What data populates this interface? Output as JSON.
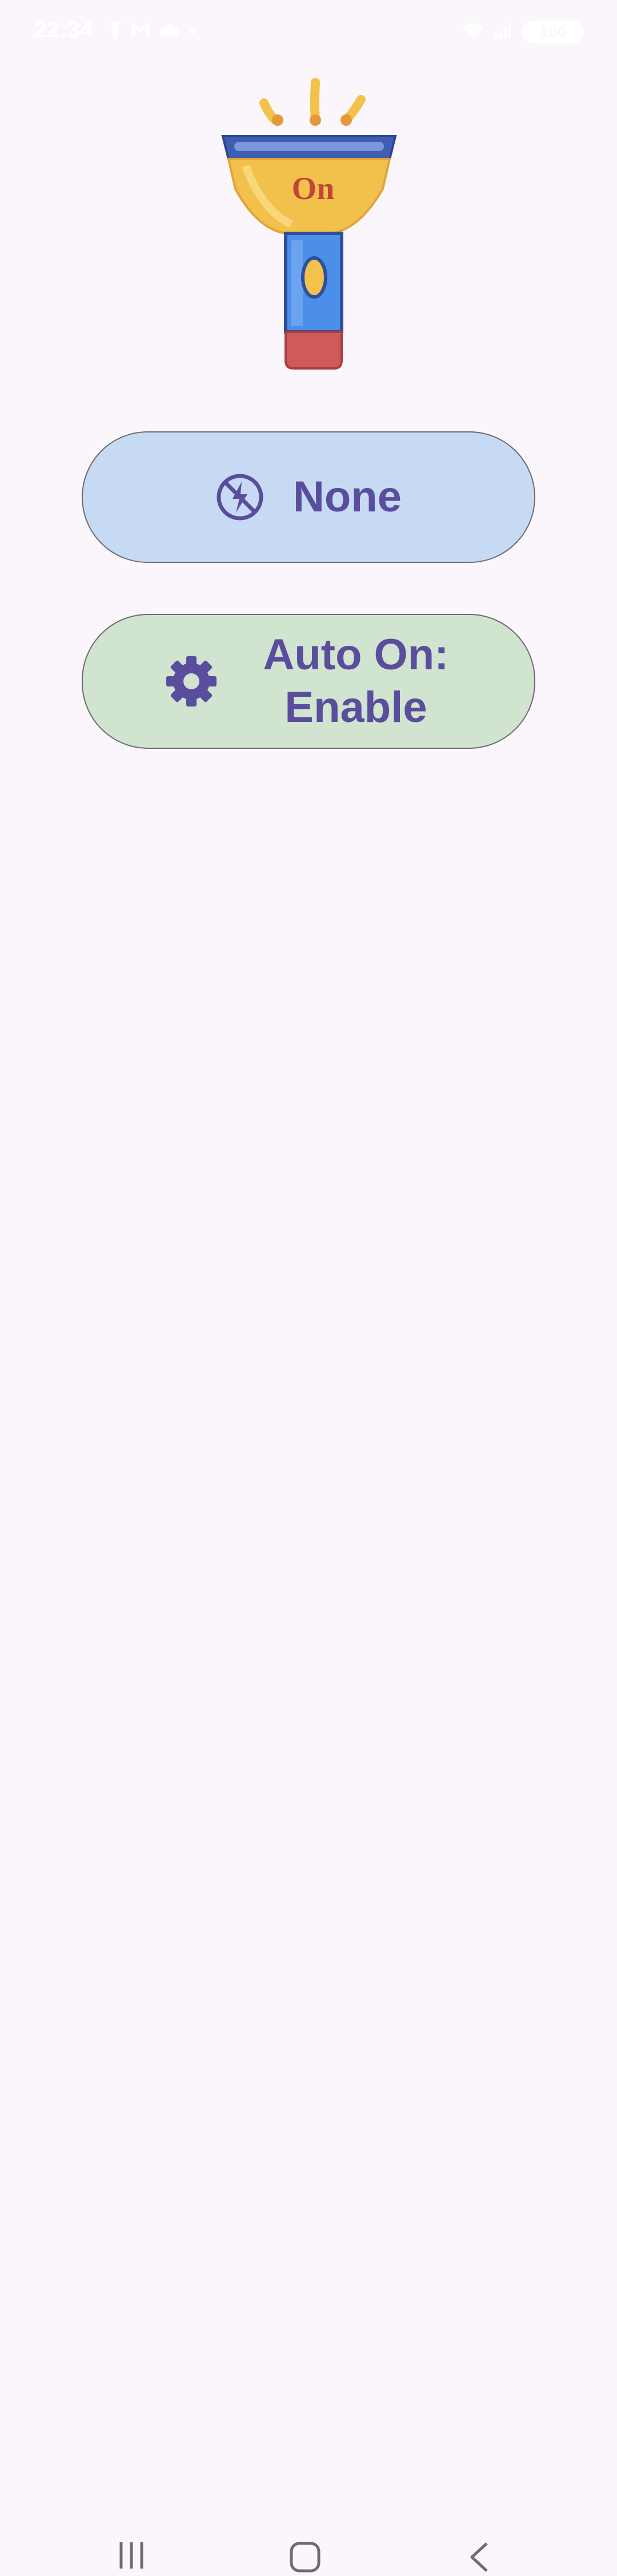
{
  "status_bar": {
    "time": "22:34",
    "battery": "100",
    "icons_left": [
      "flashlight-icon",
      "gmail-icon",
      "cloud-icon",
      "dot-icon"
    ],
    "icons_right": [
      "wifi-icon",
      "signal-icon",
      "battery-icon"
    ]
  },
  "hero": {
    "icon": "flashlight-on-icon",
    "label": "On"
  },
  "buttons": {
    "mode": {
      "label": "None",
      "icon": "flash-off-icon",
      "color": "#c6dbf3"
    },
    "auto_on": {
      "label": "Auto On: Enable",
      "icon": "gear-icon",
      "color": "#d0e4cf"
    }
  },
  "nav": {
    "items": [
      "recents-button",
      "home-button",
      "back-button"
    ]
  },
  "colors": {
    "background": "#faf6fb",
    "accent_text": "#5b4d9d"
  }
}
